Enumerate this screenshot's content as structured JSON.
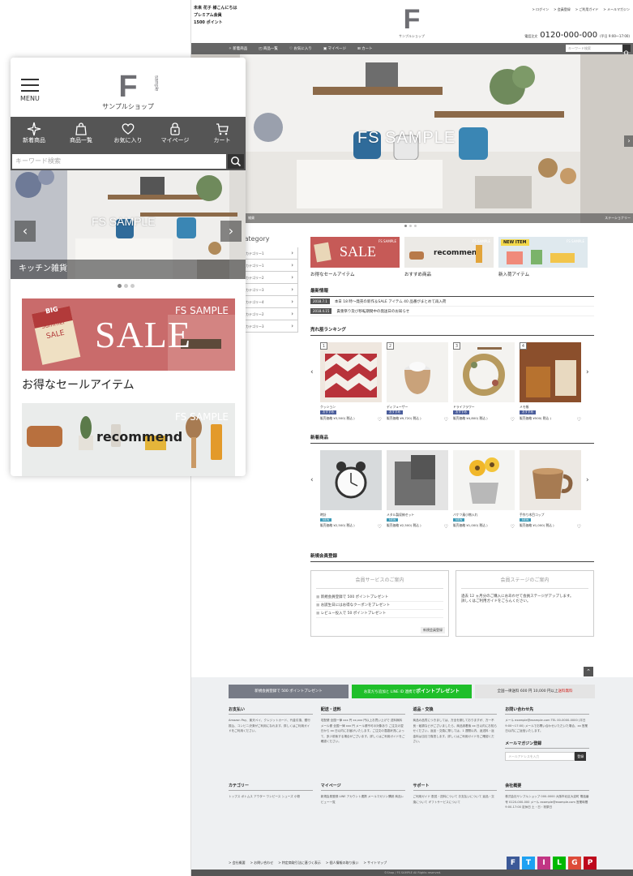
{
  "desktop": {
    "greeting": {
      "line1": "未来 花子 様こんにちは",
      "line2": "プレミアム会員",
      "line3": "1500 ポイント"
    },
    "logo": {
      "letter": "F",
      "small": "sample",
      "shop": "サンプルショップ"
    },
    "utils": [
      "> ログイン",
      "> 会員登録",
      "> ご利用ガイド",
      "> メールマガジン"
    ],
    "phone": {
      "prefix": "電話注文",
      "number": "0120-000-000",
      "hours": "(平日 9:00〜17:00)"
    },
    "nav": [
      "新着商品",
      "商品一覧",
      "お気に入り",
      "マイページ",
      "カート"
    ],
    "search_placeholder": "キーワード検索",
    "hero": {
      "title": "FS SAMPLE",
      "label": "雑貨",
      "label_right": "ステーショナリー"
    },
    "category": {
      "title": "Category",
      "items": [
        "カテゴリー1",
        "カテゴリー1",
        "カテゴリー2",
        "カテゴリー3",
        "カテゴリー4",
        "カテゴリー2",
        "カテゴリー3"
      ]
    },
    "banners": [
      {
        "caption": "お得なセールアイテム",
        "text": "SALE",
        "brand": "FS SAMPLE",
        "color": "#c0504d"
      },
      {
        "caption": "おすすめ商品",
        "text": "recommend",
        "brand": "FS SAMPLE",
        "color": "#e8e6e1"
      },
      {
        "caption": "新入荷アイテム",
        "text": "NEW ITEM",
        "brand": "FS SAMPLE",
        "color": "#d7e3ea"
      }
    ],
    "news": {
      "title": "最新情報",
      "items": [
        {
          "date": "2018.7.1",
          "text": "本日 18 時〜発売の新作＆SALE アイテム 40 品番がまとめて再入荷"
        },
        {
          "date": "2018.4.15",
          "text": "貴重祭り及び移転期間中の発送日のお知らせ"
        }
      ]
    },
    "ranking": {
      "title": "売れ筋ランキング",
      "items": [
        {
          "rank": "1",
          "name": "クッション",
          "tag": "おすすめ",
          "price": "販売価格 ¥3,500( 税込 )",
          "color": "#b8323a"
        },
        {
          "rank": "2",
          "name": "ディフューザー",
          "tag": "おすすめ",
          "price": "販売価格 ¥9,720( 税込 )",
          "color": "#c9a27a"
        },
        {
          "rank": "3",
          "name": "ドライフラワー",
          "tag": "おすすめ",
          "price": "販売価格 ¥4,800( 税込 )",
          "color": "#b79a5e"
        },
        {
          "rank": "4",
          "name": "メモ帳",
          "tag": "おすすめ",
          "price": "販売価格 ¥500( 税込 )",
          "color": "#9a5a33"
        }
      ]
    },
    "new_items": {
      "title": "新着商品",
      "items": [
        {
          "name": "時計",
          "tag": "NEW",
          "price": "販売価格 ¥2,500( 税込 )",
          "color": "#cfd3d6"
        },
        {
          "name": "メタル製収納セット",
          "tag": "NEW",
          "price": "販売価格 ¥2,500( 税込 )",
          "color": "#6f6f6f"
        },
        {
          "name": "バケツ風小物入れ",
          "tag": "NEW",
          "price": "販売価格 ¥1,000( 税込 )",
          "color": "#e4b53a"
        },
        {
          "name": "手作り木目コップ",
          "tag": "NEW",
          "price": "販売価格 ¥1,000( 税込 )",
          "color": "#a77b52"
        }
      ]
    },
    "membership": {
      "title": "新規会員登録",
      "services_title": "会員サービスのご案内",
      "services": [
        "新規会員登録で 500 ポイントプレゼント",
        "お誕生日にはお得なクーポンをプレゼント",
        "レビュー投入で 50 ポイントプレゼント"
      ],
      "register": "新規会員登録",
      "stage_title": "会員ステージのご案内",
      "stage_text1": "過去 12 ヵ月分のご購入におあわせて会員ステージがアップします。",
      "stage_text2": "詳しくはご利用ガイドをごらんください。"
    },
    "footer": {
      "btn1": "新規会員登録で 500 ポイントプレゼント",
      "btn2_a": "お友だち追加と LINE ID 連携で",
      "btn2_b": "ポイントプレゼント",
      "btn3_a": "全国一律送料 600 円 10,000 円以上",
      "btn3_b": "送料無料",
      "cols1": [
        {
          "title": "お支払い",
          "text": "Amazon Pay、楽天ペイ、クレジットカード、代金引換、銀行振込、コンビニ決済がご利用になれます。詳しくはご利用ガイドをご利用ください。"
        },
        {
          "title": "配送・送料",
          "text": "宅配便 全国一律 xxx 円 xx,xxx 円以上お買い上げで 送料無料 メール便 全国一律 xxx 円 メール便不可の対象あり ご注文の翌日から xx 日以内にお届けいたします。ご注文の混雑状況によって、多少前後する場合がございます。詳しくはご利用ガイドをご確認ください。"
        },
        {
          "title": "返品・交換",
          "text": "商品の品質につきましては、万全を期しておりますが、万一不良・破損などがございましたら、商品到着後 xx 日以内にお知らせください。返品・交換に際しては、1 週間以内、返送料・返金料は当社で負担します。詳しくはご利用ガイドをご確認ください。"
        },
        {
          "title": "お問い合わせ先",
          "text": "メール example@example.com TEL 00-0000-0000 (平日 9:00〜17:00) メールでお問い合わせいただいた場合、xx 営業日以内にご返信いたします。"
        }
      ],
      "mailmag_title": "メールマガジン登録",
      "mailmag_placeholder": "メールアドレスを入力",
      "mailmag_btn": "登録",
      "cols2": [
        {
          "title": "カテゴリー",
          "text": "トップス ボトムス アウター ワンピース シューズ 小物"
        },
        {
          "title": "マイページ",
          "text": "新規会員登録 LINE アカウント連携 メールマガジン購読 商品レビュー一覧"
        },
        {
          "title": "サポート",
          "text": "ご利用ガイド 配送・送料について お支払いについて 返品・交換について ギフトサービスについて"
        },
        {
          "title": "会社概要",
          "text": "株式会社サンプルショップ 000-0000 大阪市北区大淀町 電話番号 0120-000-000 メール example@example.com 営業時間 9:00-17:00 定休日 土・日・祝祭日"
        }
      ],
      "links": [
        "> 会社概要",
        "> お問い合わせ",
        "> 特定商取引法に基づく表示",
        "> 個人情報の取り扱い",
        "> サイトマップ"
      ],
      "social": [
        {
          "icon": "F",
          "color": "#3b5998"
        },
        {
          "icon": "T",
          "color": "#1da1f2"
        },
        {
          "icon": "I",
          "color": "#c13584"
        },
        {
          "icon": "L",
          "color": "#00b900"
        },
        {
          "icon": "G",
          "color": "#dd4b39"
        },
        {
          "icon": "P",
          "color": "#bd081c"
        }
      ],
      "copyright": "©Shop / FS SAMPLE All Rights reserved."
    }
  },
  "mobile": {
    "menu_label": "MENU",
    "logo": {
      "letter": "F",
      "small": "sample",
      "shop": "サンプルショップ"
    },
    "nav": [
      "新着商品",
      "商品一覧",
      "お気に入り",
      "マイページ",
      "カート"
    ],
    "search_placeholder": "キーワード検索",
    "hero": {
      "title": "FS SAMPLE",
      "label": "キッチン雑貨"
    },
    "sale": {
      "title": "SALE",
      "brand": "FS SAMPLE",
      "tag1": "BIG",
      "tag2": "Summer",
      "tag3": "SALE",
      "caption": "お得なセールアイテム"
    },
    "recommend": {
      "title": "recommend",
      "brand": "FS SAMPLE"
    }
  }
}
